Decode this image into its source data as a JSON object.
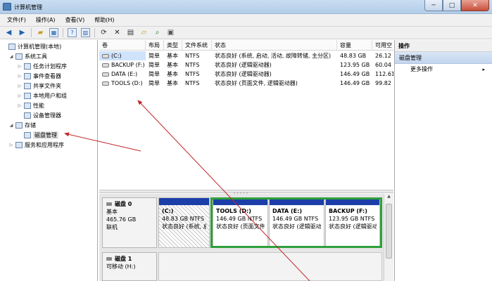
{
  "window": {
    "title": "计算机管理",
    "min": "─",
    "max": "□",
    "close": "✕"
  },
  "menu": [
    "文件(F)",
    "操作(A)",
    "查看(V)",
    "帮助(H)"
  ],
  "toolbar_icons": [
    "back-arrow-icon",
    "forward-arrow-icon",
    "folder-up-icon",
    "panel-icon",
    "help-icon",
    "panel-icon",
    "refresh-icon",
    "delete-icon",
    "properties-icon",
    "open-folder-icon",
    "search-icon",
    "settings-icon"
  ],
  "tree": [
    {
      "label": "计算机管理(本地)",
      "level": 0,
      "expander": "",
      "selected": false
    },
    {
      "label": "系统工具",
      "level": 1,
      "expander": "◢",
      "selected": false
    },
    {
      "label": "任务计划程序",
      "level": 2,
      "expander": "▷",
      "selected": false
    },
    {
      "label": "事件查看器",
      "level": 2,
      "expander": "▷",
      "selected": false
    },
    {
      "label": "共享文件夹",
      "level": 2,
      "expander": "▷",
      "selected": false
    },
    {
      "label": "本地用户和组",
      "level": 2,
      "expander": "▷",
      "selected": false
    },
    {
      "label": "性能",
      "level": 2,
      "expander": "▷",
      "selected": false
    },
    {
      "label": "设备管理器",
      "level": 2,
      "expander": "",
      "selected": false
    },
    {
      "label": "存储",
      "level": 1,
      "expander": "◢",
      "selected": false
    },
    {
      "label": "磁盘管理",
      "level": 2,
      "expander": "",
      "selected": true
    },
    {
      "label": "服务和应用程序",
      "level": 1,
      "expander": "▷",
      "selected": false
    }
  ],
  "columns": [
    "卷",
    "布局",
    "类型",
    "文件系统",
    "状态",
    "容量",
    "可用空"
  ],
  "volumes": [
    {
      "name": "(C:)",
      "layout": "简单",
      "type": "基本",
      "fs": "NTFS",
      "status": "状态良好 (系统, 启动, 活动, 故障转储, 主分区)",
      "capacity": "48.83 GB",
      "free": "26.12"
    },
    {
      "name": "BACKUP (F:)",
      "layout": "简单",
      "type": "基本",
      "fs": "NTFS",
      "status": "状态良好 (逻辑驱动器)",
      "capacity": "123.95 GB",
      "free": "60.04"
    },
    {
      "name": "DATA (E:)",
      "layout": "简单",
      "type": "基本",
      "fs": "NTFS",
      "status": "状态良好 (逻辑驱动器)",
      "capacity": "146.49 GB",
      "free": "112.61"
    },
    {
      "name": "TOOLS (D:)",
      "layout": "简单",
      "type": "基本",
      "fs": "NTFS",
      "status": "状态良好 (页面文件, 逻辑驱动器)",
      "capacity": "146.49 GB",
      "free": "99.82"
    }
  ],
  "disk0": {
    "name": "磁盘 0",
    "type": "基本",
    "size": "465.76 GB",
    "state": "联机"
  },
  "partitions": [
    {
      "name": "(C:)",
      "size": "48.83 GB NTFS",
      "status": "状态良好 (系统, 启动"
    },
    {
      "name": "TOOLS  (D:)",
      "size": "146.49 GB NTFS",
      "status": "状态良好 (页面文件"
    },
    {
      "name": "DATA  (E:)",
      "size": "146.49 GB NTFS",
      "status": "状态良好 (逻辑驱动器"
    },
    {
      "name": "BACKUP  (F:)",
      "size": "123.95 GB NTFS",
      "status": "状态良好 (逻辑驱动器"
    }
  ],
  "disk1": {
    "name": "磁盘 1",
    "type": "可移动 (H:)"
  },
  "actions": {
    "header": "操作",
    "section": "磁盘管理",
    "more": "更多操作",
    "more_arrow": "▸"
  },
  "colors": {
    "partition_cap": "#1b3ea8",
    "extended_frame": "#2fa03a",
    "annotation_arrow": "#c0282a"
  }
}
